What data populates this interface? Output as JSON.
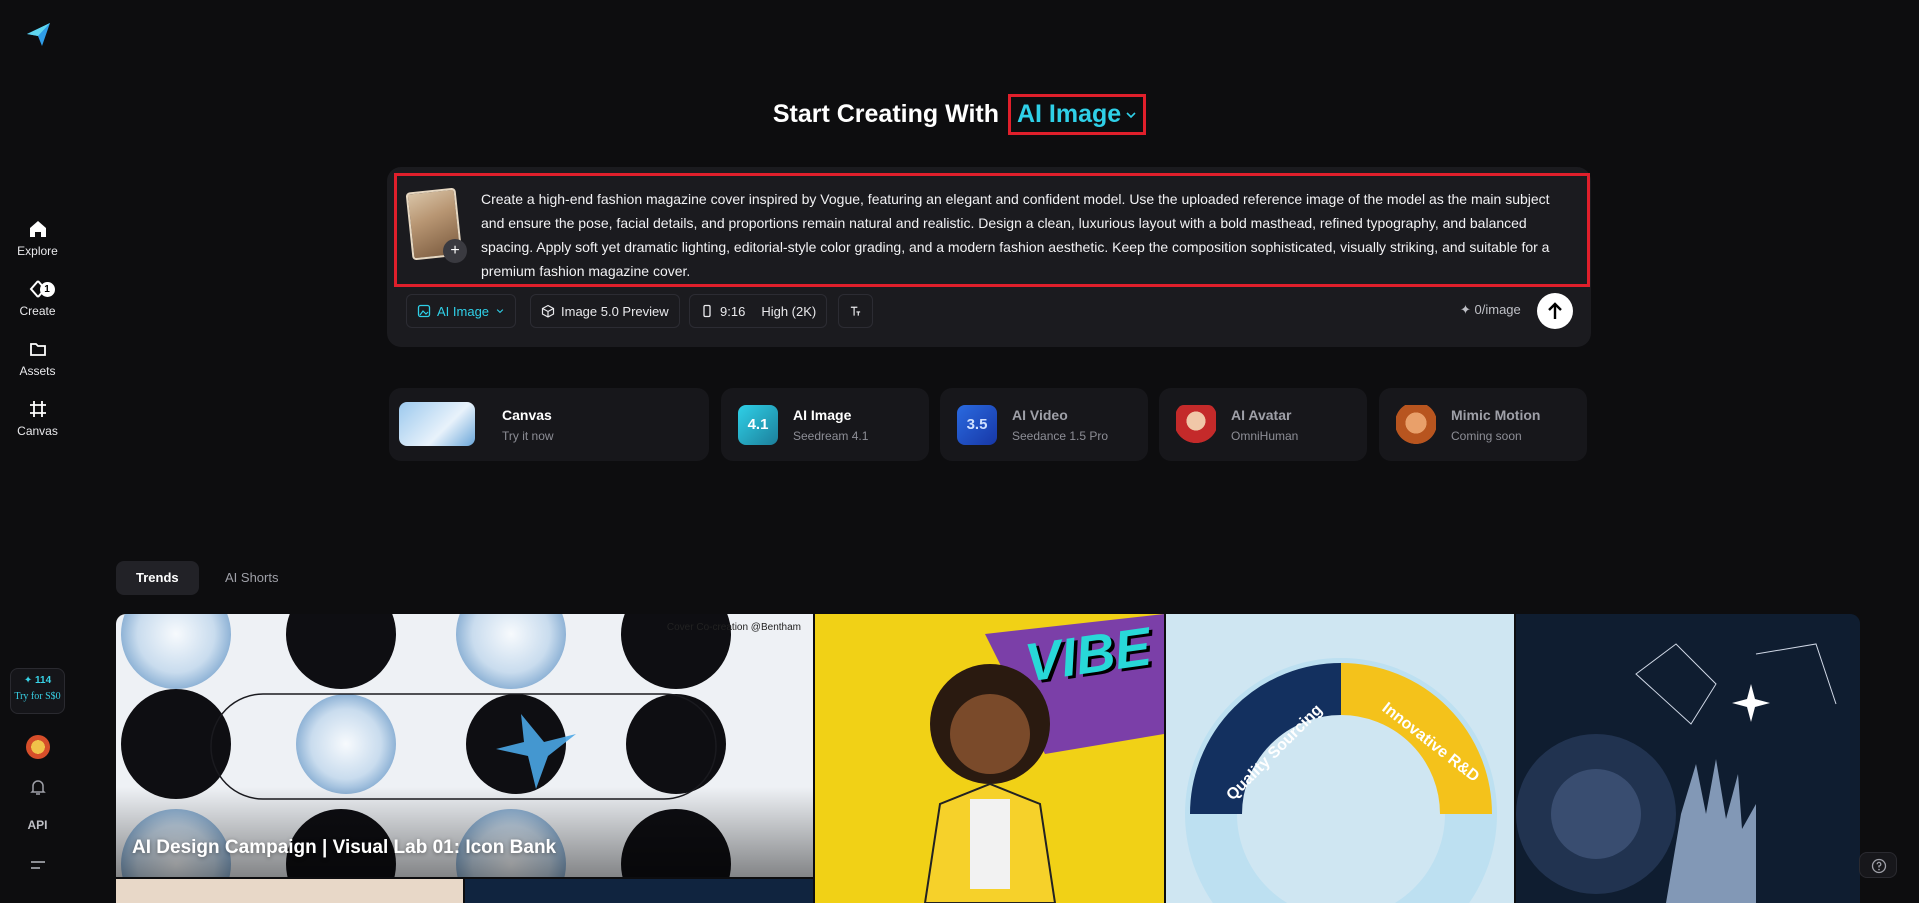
{
  "nav": {
    "items": [
      {
        "label": "Explore",
        "icon": "home-icon"
      },
      {
        "label": "Create",
        "icon": "create-icon",
        "badge": "1"
      },
      {
        "label": "Assets",
        "icon": "folder-icon"
      },
      {
        "label": "Canvas",
        "icon": "canvas-icon"
      }
    ],
    "credits": {
      "amount": "✦ 114",
      "cta": "Try for S$0"
    },
    "api_label": "API"
  },
  "headline": {
    "prefix": "Start Creating With",
    "mode": "AI Image"
  },
  "prompt": {
    "text": "Create a high-end fashion magazine cover inspired by Vogue, featuring an elegant and confident model. Use the uploaded reference image of the model as the main subject and ensure the pose, facial details, and proportions remain natural and realistic. Design a clean, luxurious layout with a bold masthead, refined typography, and balanced spacing. Apply soft yet dramatic lighting, editorial-style color grading, and a modern fashion aesthetic. Keep the composition sophisticated, visually striking, and suitable for a premium fashion magazine cover.",
    "add_label": "+"
  },
  "toolbar": {
    "mode": "AI Image",
    "model": "Image 5.0 Preview",
    "ratio": "9:16",
    "quality": "High (2K)",
    "cost": "✦ 0/image"
  },
  "tools": [
    {
      "title": "Canvas",
      "sub": "Try it now"
    },
    {
      "title": "AI Image",
      "sub": "Seedream 4.1",
      "icon_text": "4.1"
    },
    {
      "title": "AI Video",
      "sub": "Seedance 1.5 Pro",
      "icon_text": "3.5"
    },
    {
      "title": "AI Avatar",
      "sub": "OmniHuman"
    },
    {
      "title": "Mimic Motion",
      "sub": "Coming soon"
    }
  ],
  "tabs": [
    {
      "label": "Trends",
      "active": true
    },
    {
      "label": "AI Shorts",
      "active": false
    }
  ],
  "gallery": {
    "feature_title": "AI Design Campaign | Visual Lab 01: Icon Bank",
    "feature_credit": "Cover Co-creation @Bentham",
    "vibe_text": "VIBE",
    "ring_labels": [
      "Quality Sourcing",
      "Innovative R&D"
    ]
  },
  "colors": {
    "accent": "#2fd0e8",
    "highlight": "#e01f2b",
    "background": "#0d0d0f"
  }
}
